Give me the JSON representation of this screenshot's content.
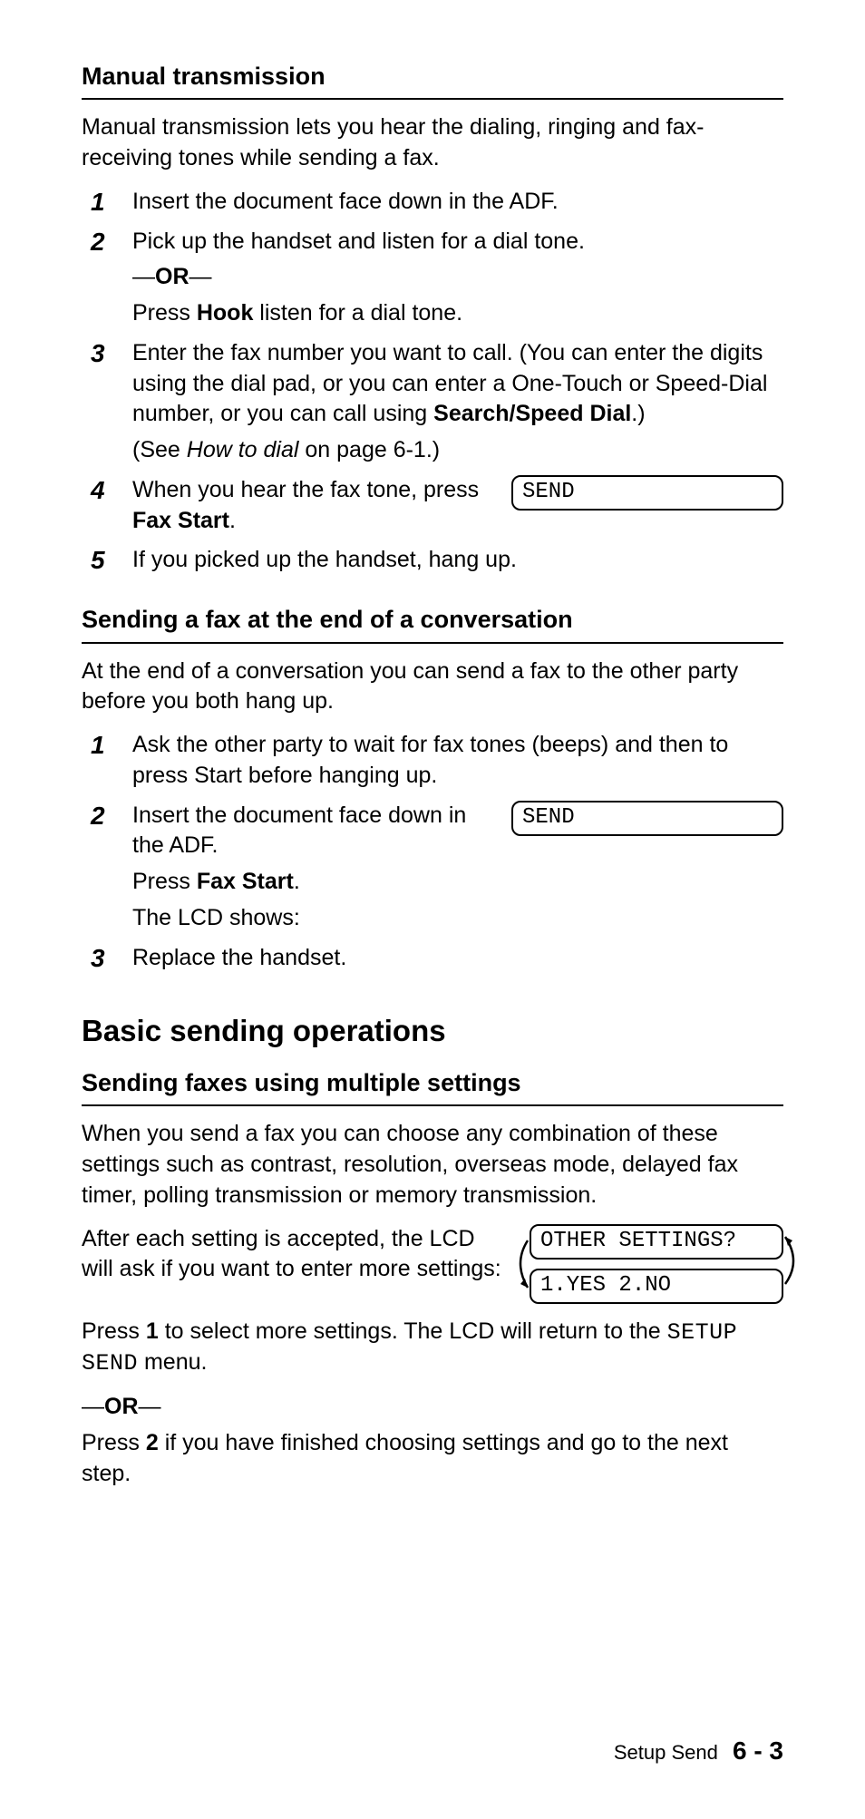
{
  "section1": {
    "heading": "Manual transmission",
    "intro": "Manual transmission lets you hear the dialing, ringing and fax-receiving tones while sending a fax.",
    "steps": [
      {
        "n": "1",
        "lines": [
          {
            "type": "p",
            "runs": [
              {
                "t": "Insert the document face down in the ADF."
              }
            ]
          }
        ]
      },
      {
        "n": "2",
        "lines": [
          {
            "type": "p",
            "runs": [
              {
                "t": "Pick up the handset and listen for a dial tone."
              }
            ]
          },
          {
            "type": "or"
          },
          {
            "type": "p",
            "runs": [
              {
                "t": "Press "
              },
              {
                "t": "Hook",
                "b": true
              },
              {
                "t": " listen for a dial tone."
              }
            ]
          }
        ]
      },
      {
        "n": "3",
        "lines": [
          {
            "type": "p",
            "runs": [
              {
                "t": "Enter the fax number you want to call. (You can enter the digits using the dial pad, or you can enter a One-Touch or Speed-Dial number, or you can call using "
              },
              {
                "t": "Search/Speed Dial",
                "b": true
              },
              {
                "t": ".)"
              }
            ]
          },
          {
            "type": "p",
            "runs": [
              {
                "t": "(See "
              },
              {
                "t": "How to dial",
                "i": true
              },
              {
                "t": " on page 6-1.)"
              }
            ]
          }
        ]
      },
      {
        "n": "4",
        "lcd": "SEND",
        "lines": [
          {
            "type": "p",
            "runs": [
              {
                "t": "When you hear the fax tone, press "
              },
              {
                "t": "Fax Start",
                "b": true
              },
              {
                "t": "."
              }
            ]
          }
        ]
      },
      {
        "n": "5",
        "lines": [
          {
            "type": "p",
            "runs": [
              {
                "t": "If you picked up the handset, hang up."
              }
            ]
          }
        ]
      }
    ]
  },
  "section2": {
    "heading": "Sending a fax at the end of a conversation",
    "intro": "At the end of a conversation you can send a fax to the other party before you both hang up.",
    "steps": [
      {
        "n": "1",
        "lines": [
          {
            "type": "p",
            "runs": [
              {
                "t": "Ask the other party to wait for fax tones (beeps) and then to press Start before hanging up."
              }
            ]
          }
        ]
      },
      {
        "n": "2",
        "lcd": "SEND",
        "lines": [
          {
            "type": "p",
            "runs": [
              {
                "t": "Insert the document face down in the ADF."
              }
            ]
          },
          {
            "type": "p",
            "runs": [
              {
                "t": "Press "
              },
              {
                "t": "Fax Start",
                "b": true
              },
              {
                "t": "."
              }
            ]
          },
          {
            "type": "p",
            "runs": [
              {
                "t": "The LCD shows:"
              }
            ]
          }
        ]
      },
      {
        "n": "3",
        "lines": [
          {
            "type": "p",
            "runs": [
              {
                "t": "Replace the handset."
              }
            ]
          }
        ]
      }
    ]
  },
  "section3": {
    "h2": "Basic sending operations",
    "heading": "Sending faxes using multiple settings",
    "intro": "When you send a fax you can choose any combination of these settings such as contrast, resolution, overseas mode, delayed fax timer, polling transmission or memory transmission.",
    "afterRow": {
      "left": "After each setting is accepted, the LCD will ask if you want to enter more settings:",
      "lcd1": "OTHER SETTINGS?",
      "lcd2": "1.YES 2.NO"
    },
    "p2runs": [
      {
        "t": "Press "
      },
      {
        "t": "1",
        "b": true
      },
      {
        "t": " to select more settings. The LCD will return to the "
      },
      {
        "t": "SETUP SEND",
        "mono": true
      },
      {
        "t": " menu."
      }
    ],
    "p3runs": [
      {
        "t": "Press "
      },
      {
        "t": "2",
        "b": true
      },
      {
        "t": " if you have finished choosing settings and go to the next step."
      }
    ],
    "orWord": "OR"
  },
  "footer": {
    "label": "Setup Send",
    "page": "6 - 3"
  }
}
